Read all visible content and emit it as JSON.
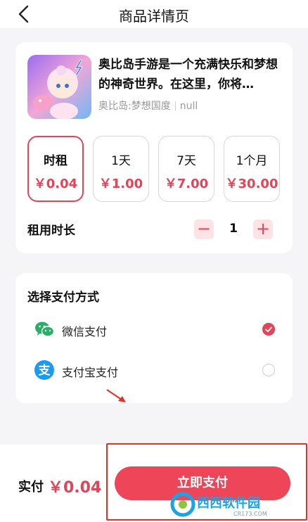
{
  "header": {
    "title": "商品详情页"
  },
  "product": {
    "description": "奥比岛手游是一个充满快乐和梦想的神奇世界。在这里，你将…",
    "game_name": "奥比岛:梦想国度",
    "extra": "null"
  },
  "rental_options": [
    {
      "label": "时租",
      "price": "￥0.04",
      "selected": true
    },
    {
      "label": "1天",
      "price": "￥1.00",
      "selected": false
    },
    {
      "label": "7天",
      "price": "￥7.00",
      "selected": false
    },
    {
      "label": "1个月",
      "price": "￥30.00",
      "selected": false
    }
  ],
  "duration": {
    "label": "租用时长",
    "minus": "−",
    "plus": "+",
    "quantity": "1"
  },
  "payment": {
    "title": "选择支付方式",
    "methods": [
      {
        "name": "微信支付",
        "icon": "wechat-pay-icon",
        "selected": true
      },
      {
        "name": "支付宝支付",
        "icon": "alipay-icon",
        "selected": false
      }
    ]
  },
  "footer": {
    "total_label": "实付",
    "total_amount": "￥0.04",
    "pay_button": "立即支付"
  },
  "watermark": {
    "brand": "西西软件园",
    "site": "CR173.COM"
  },
  "colors": {
    "accent": "#e0455a",
    "button": "#ef4558",
    "highlight": "#e0302a",
    "wechat": "#2aae67",
    "alipay": "#1a9bf0"
  }
}
